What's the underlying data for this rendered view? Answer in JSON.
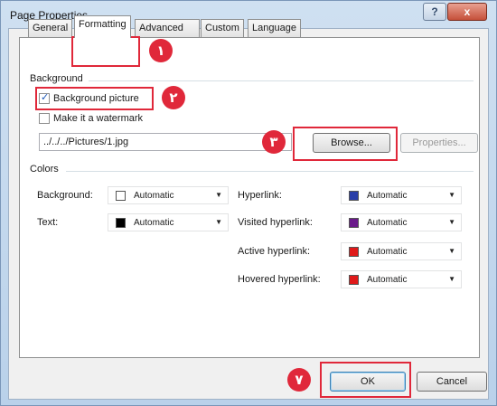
{
  "window": {
    "title": "Page Properties",
    "help_glyph": "?",
    "close_glyph": "x"
  },
  "tabs": [
    {
      "label": "General"
    },
    {
      "label": "Formatting"
    },
    {
      "label": "Advanced"
    },
    {
      "label": "Custom"
    },
    {
      "label": "Language"
    }
  ],
  "background": {
    "group_label": "Background",
    "background_picture": {
      "label": "Background picture",
      "checked": true
    },
    "watermark": {
      "label": "Make it a watermark",
      "checked": false
    },
    "path_value": "../../../Pictures/1.jpg",
    "browse_label": "Browse...",
    "properties_label": "Properties..."
  },
  "colors": {
    "group_label": "Colors",
    "left": [
      {
        "label": "Background:",
        "value": "Automatic",
        "swatch": "#ffffff"
      },
      {
        "label": "Text:",
        "value": "Automatic",
        "swatch": "#000000"
      }
    ],
    "right": [
      {
        "label": "Hyperlink:",
        "value": "Automatic",
        "swatch": "#2a3ea8"
      },
      {
        "label": "Visited hyperlink:",
        "value": "Automatic",
        "swatch": "#6a1a8a"
      },
      {
        "label": "Active hyperlink:",
        "value": "Automatic",
        "swatch": "#e01a1a"
      },
      {
        "label": "Hovered hyperlink:",
        "value": "Automatic",
        "swatch": "#e01a1a"
      }
    ]
  },
  "footer": {
    "ok_label": "OK",
    "cancel_label": "Cancel"
  },
  "markers": [
    "١",
    "٢",
    "٣",
    "٧"
  ],
  "accent_color": "#e0283a"
}
